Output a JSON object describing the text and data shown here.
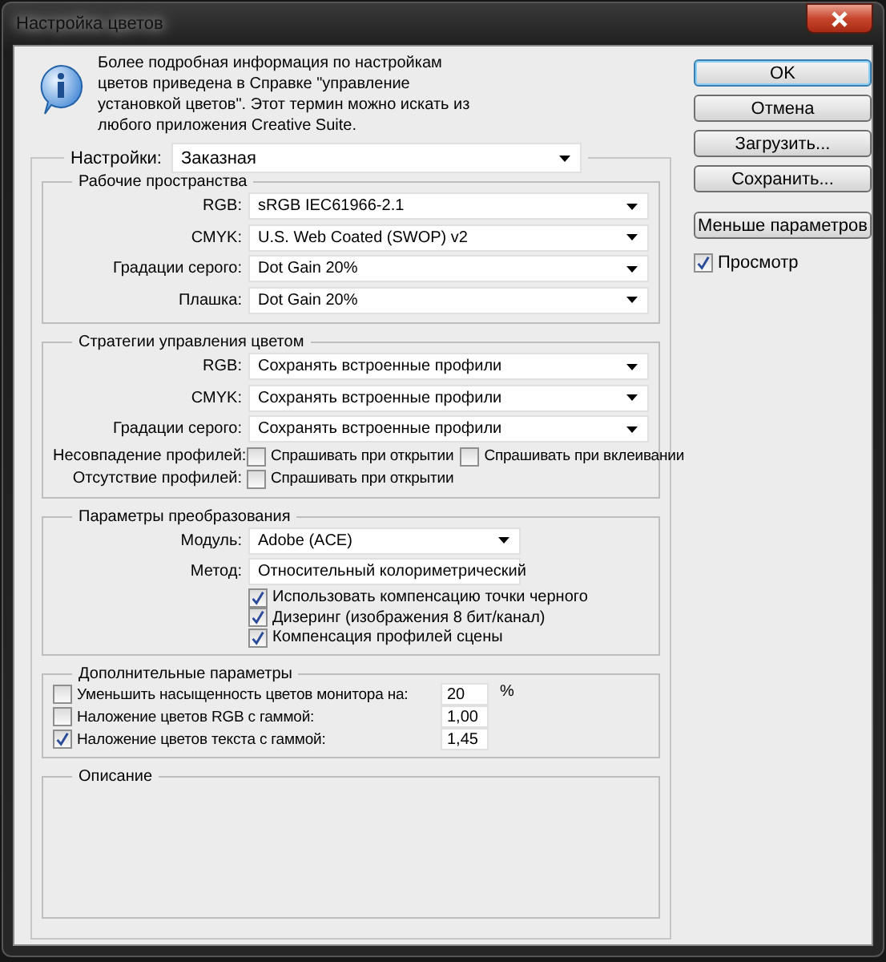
{
  "window": {
    "title": "Настройка цветов"
  },
  "info": {
    "text": "Более подробная информация по настройкам цветов приведена в Справке \"управление установкой цветов\". Этот термин можно искать из любого приложения Creative Suite."
  },
  "settings": {
    "label": "Настройки:",
    "value": "Заказная"
  },
  "groups": [
    {
      "kind": "profiles",
      "title": "Рабочие пространства",
      "rows": [
        {
          "kind": "select",
          "label": "RGB:",
          "value": "sRGB IEC61966-2.1"
        },
        {
          "kind": "select",
          "label": "CMYK:",
          "value": "U.S. Web Coated (SWOP) v2"
        },
        {
          "kind": "select",
          "label": "Градации серого:",
          "value": "Dot Gain 20%"
        },
        {
          "kind": "select",
          "label": "Плашка:",
          "value": "Dot Gain 20%"
        }
      ]
    },
    {
      "kind": "policies",
      "title": "Стратегии управления цветом",
      "rows": [
        {
          "kind": "select",
          "label": "RGB:",
          "value": "Сохранять встроенные профили"
        },
        {
          "kind": "select",
          "label": "CMYK:",
          "value": "Сохранять встроенные профили"
        },
        {
          "kind": "select",
          "label": "Градации серого:",
          "value": "Сохранять встроенные профили"
        },
        {
          "kind": "checks",
          "label": "Несовпадение профилей:",
          "options": [
            {
              "label": "Спрашивать при открытии",
              "checked": false
            },
            {
              "label": "Спрашивать при вклеивании",
              "checked": false
            }
          ]
        },
        {
          "kind": "checks",
          "label": "Отсутствие профилей:",
          "options": [
            {
              "label": "Спрашивать при открытии",
              "checked": false
            }
          ]
        }
      ]
    },
    {
      "kind": "conversion",
      "title": "Параметры преобразования",
      "rows": [
        {
          "kind": "select",
          "label": "Модуль:",
          "value": "Adobe (ACE)"
        },
        {
          "kind": "select",
          "label": "Метод:",
          "value": "Относительный колориметрический"
        },
        {
          "kind": "check",
          "label": "Использовать компенсацию точки черного",
          "checked": true
        },
        {
          "kind": "check",
          "label": "Дизеринг (изображения 8 бит/канал)",
          "checked": true
        },
        {
          "kind": "check",
          "label": "Компенсация профилей сцены",
          "checked": true
        }
      ]
    },
    {
      "kind": "advanced",
      "title": "Дополнительные параметры",
      "rows": [
        {
          "kind": "check_input",
          "label": "Уменьшить насыщенность цветов монитора на:",
          "checked": false,
          "value": "20",
          "unit": "%"
        },
        {
          "kind": "check_input",
          "label": "Наложение цветов RGB с гаммой:",
          "checked": false,
          "value": "1,00"
        },
        {
          "kind": "check_input",
          "label": "Наложение цветов текста с гаммой:",
          "checked": true,
          "value": "1,45"
        }
      ]
    },
    {
      "kind": "description",
      "title": "Описание"
    }
  ],
  "buttons": [
    {
      "label": "OK",
      "default": true
    },
    {
      "label": "Отмена",
      "default": false
    },
    {
      "label": "Загрузить...",
      "default": false
    },
    {
      "label": "Сохранить...",
      "default": false
    },
    {
      "label": "Меньше параметров",
      "default": false
    }
  ],
  "preview": {
    "label": "Просмотр",
    "checked": true
  }
}
